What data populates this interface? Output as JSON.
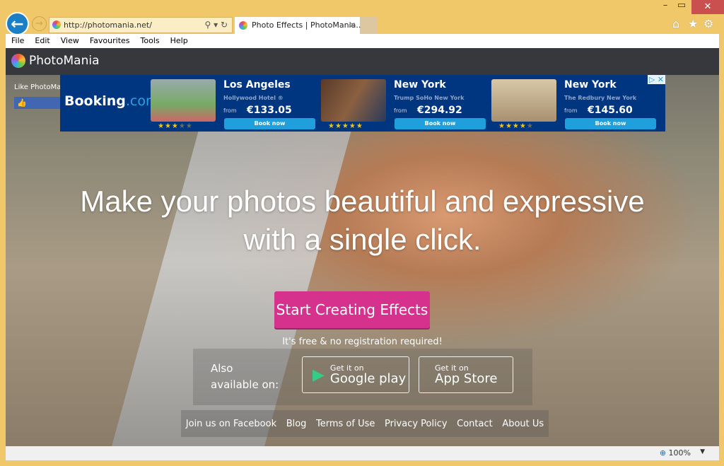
{
  "browser": {
    "url": "http://photomania.net/",
    "tab_title": "Photo Effects | PhotoMania...",
    "menu": [
      "File",
      "Edit",
      "View",
      "Favourites",
      "Tools",
      "Help"
    ],
    "zoom": "100%"
  },
  "site": {
    "logo": "PhotoMania",
    "like_label": "Like PhotoMania",
    "ad": {
      "brand_a": "Booking",
      "brand_b": ".com",
      "hotels": [
        {
          "city": "Los Angeles",
          "name": "Hollywood Hotel ®",
          "from": "from",
          "price": "€133.05",
          "book": "Book now",
          "stars": 3
        },
        {
          "city": "New York",
          "name": "Trump SoHo New York",
          "from": "from",
          "price": "€294.92",
          "book": "Book now",
          "stars": 5
        },
        {
          "city": "New York",
          "name": "The Redbury New York",
          "from": "from",
          "price": "€145.60",
          "book": "Book now",
          "stars": 4
        }
      ]
    },
    "headline_1": "Make your photos beautiful and expressive",
    "headline_2": "with a single click.",
    "cta": "Start Creating Effects",
    "free_note": "It's free & no registration required!",
    "also_available": "Also available on:",
    "google_play": {
      "small": "Get it on",
      "big": "Google play"
    },
    "app_store": {
      "small": "Get it on",
      "big": "App Store"
    },
    "footer": [
      "Join us on Facebook",
      "Blog",
      "Terms of Use",
      "Privacy Policy",
      "Contact",
      "About Us"
    ]
  }
}
